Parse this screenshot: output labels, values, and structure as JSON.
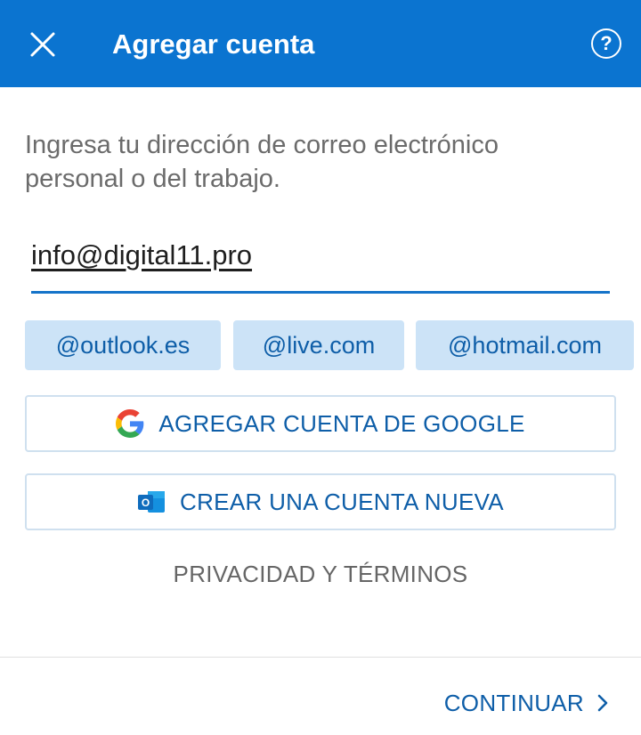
{
  "header": {
    "title": "Agregar cuenta",
    "help_symbol": "?"
  },
  "instructions": "Ingresa tu dirección de correo electrónico personal o del trabajo.",
  "email": {
    "value": "info@digital11.pro"
  },
  "domain_suggestions": [
    "@outlook.es",
    "@live.com",
    "@hotmail.com"
  ],
  "buttons": {
    "google": "AGREGAR CUENTA DE GOOGLE",
    "create_new": "CREAR UNA CUENTA NUEVA",
    "privacy": "PRIVACIDAD Y TÉRMINOS",
    "continue": "CONTINUAR"
  },
  "icons": {
    "close": "close-icon",
    "help": "help-icon",
    "google": "google-logo-icon",
    "outlook": "outlook-logo-icon",
    "continue": "chevron-right-icon"
  },
  "colors": {
    "header_bg": "#0b74d0",
    "accent": "#0e5ea8",
    "chip_bg": "#cce3f7",
    "input_underline": "#1473c9"
  }
}
